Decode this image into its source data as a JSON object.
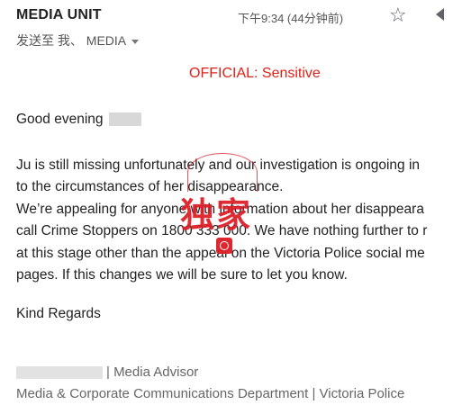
{
  "header": {
    "sender": "MEDIA UNIT",
    "timestamp": "下午9:34 (44分钟前)",
    "recipients": "发送至 我、 MEDIA"
  },
  "icons": {
    "star": "star-icon",
    "more": "more-options-icon",
    "recipients_expand": "chevron-down-icon"
  },
  "classification": "OFFICIAL: Sensitive",
  "message": {
    "greeting": "Good evening",
    "lines": [
      "Ju is still missing unfortunately and our investigation is ongoing in",
      "to the circumstances of her disappearance.",
      "We’re appealing for anyone with information about her disappeara",
      "call Crime Stoppers on 1800 333 000. We have nothing further to r",
      "at this stage other than the appeal on the Victoria Police social me",
      "pages. If this changes we will be sure to let you know."
    ],
    "closing": "Kind Regards"
  },
  "signature": {
    "title": "| Media Advisor",
    "department": "Media & Corporate Communications Department | Victoria Police"
  },
  "watermark": {
    "text": "独家"
  },
  "colors": {
    "classification": "#e0201a",
    "watermark": "#dc1c26"
  }
}
